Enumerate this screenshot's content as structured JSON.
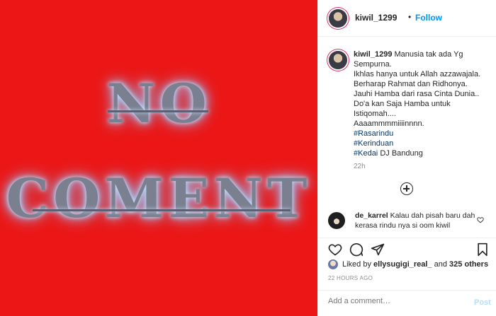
{
  "post": {
    "overlay_line1": "NO",
    "overlay_line2": "COMENT"
  },
  "header": {
    "username": "kiwil_1299",
    "separator": "•",
    "follow_label": "Follow"
  },
  "caption": {
    "username": "kiwil_1299",
    "lines": [
      "Manusia tak ada Yg Sempurna.",
      "Ikhlas hanya untuk Allah azzawajala.",
      "Berharap Rahmat dan Ridhonya.",
      "Jauhi Hamba dari rasa Cinta Dunia..",
      "Do'a kan Saja Hamba untuk Istiqomah....",
      "Aaaammmmiiiinnnn."
    ],
    "hashtags": [
      "#Rasarindu",
      "#Kerinduan"
    ],
    "last_hashtag": "#Kedai",
    "last_suffix": " DJ Bandung",
    "time": "22h"
  },
  "comment": {
    "username": "de_karrel",
    "text": "Kalau dah pisah baru dah kerasa rindu nya si oom kiwil"
  },
  "likes": {
    "prefix": "Liked by ",
    "user": "ellysugigi_real_",
    "middle": " and ",
    "others": "325 others"
  },
  "timestamp": "22 HOURS AGO",
  "add_comment": {
    "placeholder": "Add a comment…",
    "post_label": "Post"
  },
  "colors": {
    "image_background": "#ec1616",
    "accent": "#0095f6",
    "hashtag": "#00376b"
  },
  "icons": {
    "like": "heart-icon",
    "comment": "speech-bubble-icon",
    "share": "paper-plane-icon",
    "save": "bookmark-icon",
    "comment_like": "small-heart-icon",
    "load_more": "plus-circle-icon"
  }
}
